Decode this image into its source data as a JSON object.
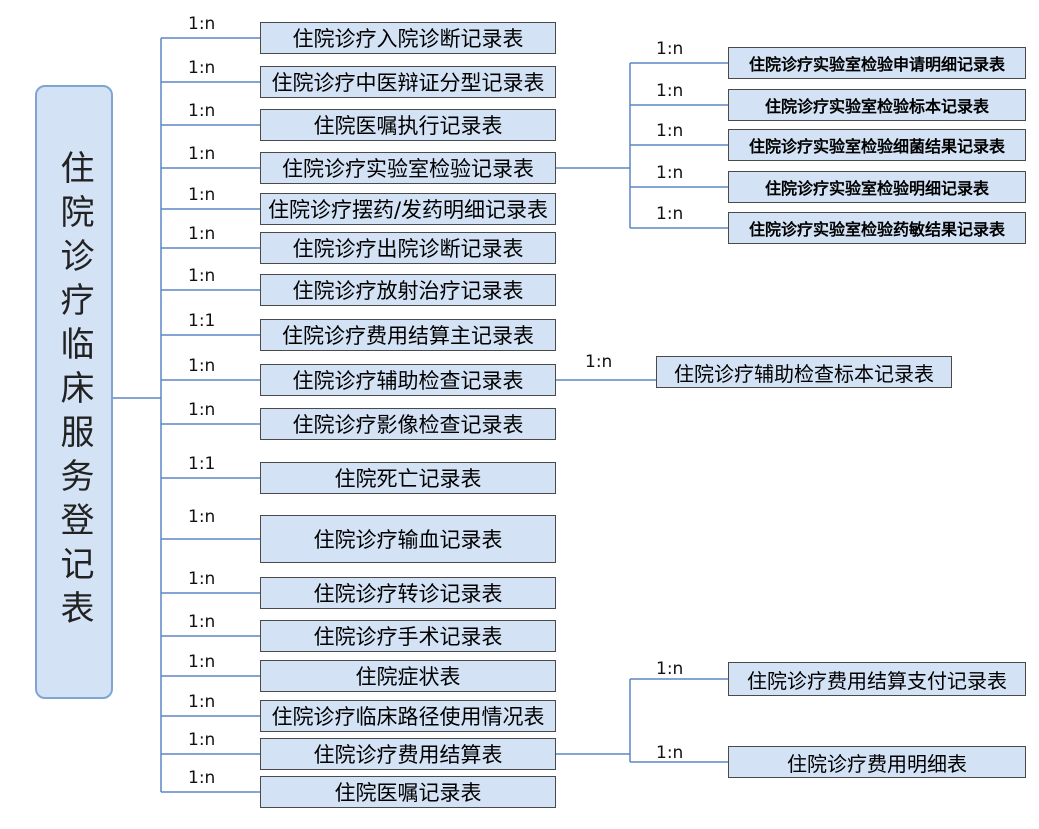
{
  "root": {
    "label": "住院诊疗临床服务登记表"
  },
  "tables": [
    {
      "label": "住院诊疗入院诊断记录表",
      "card": "1:n"
    },
    {
      "label": "住院诊疗中医辩证分型记录表",
      "card": "1:n"
    },
    {
      "label": "住院医嘱执行记录表",
      "card": "1:n"
    },
    {
      "label": "住院诊疗实验室检验记录表",
      "card": "1:n"
    },
    {
      "label": "住院诊疗摆药/发药明细记录表",
      "card": "1:n"
    },
    {
      "label": "住院诊疗出院诊断记录表",
      "card": "1:n"
    },
    {
      "label": "住院诊疗放射治疗记录表",
      "card": "1:n"
    },
    {
      "label": "住院诊疗费用结算主记录表",
      "card": "1:1"
    },
    {
      "label": "住院诊疗辅助检查记录表",
      "card": "1:n"
    },
    {
      "label": "住院诊疗影像检查记录表",
      "card": "1:n"
    },
    {
      "label": "住院死亡记录表",
      "card": "1:1"
    },
    {
      "label": "住院诊疗输血记录表",
      "card": "1:n"
    },
    {
      "label": "住院诊疗转诊记录表",
      "card": "1:n"
    },
    {
      "label": "住院诊疗手术记录表",
      "card": "1:n"
    },
    {
      "label": "住院症状表",
      "card": "1:n"
    },
    {
      "label": "住院诊疗临床路径使用情况表",
      "card": "1:n"
    },
    {
      "label": "住院诊疗费用结算表",
      "card": "1:n"
    },
    {
      "label": "住院医嘱记录表",
      "card": "1:n"
    }
  ],
  "lab_children": [
    {
      "label": "住院诊疗实验室检验申请明细记录表",
      "card": "1:n"
    },
    {
      "label": "住院诊疗实验室检验标本记录表",
      "card": "1:n"
    },
    {
      "label": "住院诊疗实验室检验细菌结果记录表",
      "card": "1:n"
    },
    {
      "label": "住院诊疗实验室检验明细记录表",
      "card": "1:n"
    },
    {
      "label": "住院诊疗实验室检验药敏结果记录表",
      "card": "1:n"
    }
  ],
  "aux_child": {
    "label": "住院诊疗辅助检查标本记录表",
    "card": "1:n"
  },
  "fee_children": [
    {
      "label": "住院诊疗费用结算支付记录表",
      "card": "1:n"
    },
    {
      "label": "住院诊疗费用明细表",
      "card": "1:n"
    }
  ]
}
